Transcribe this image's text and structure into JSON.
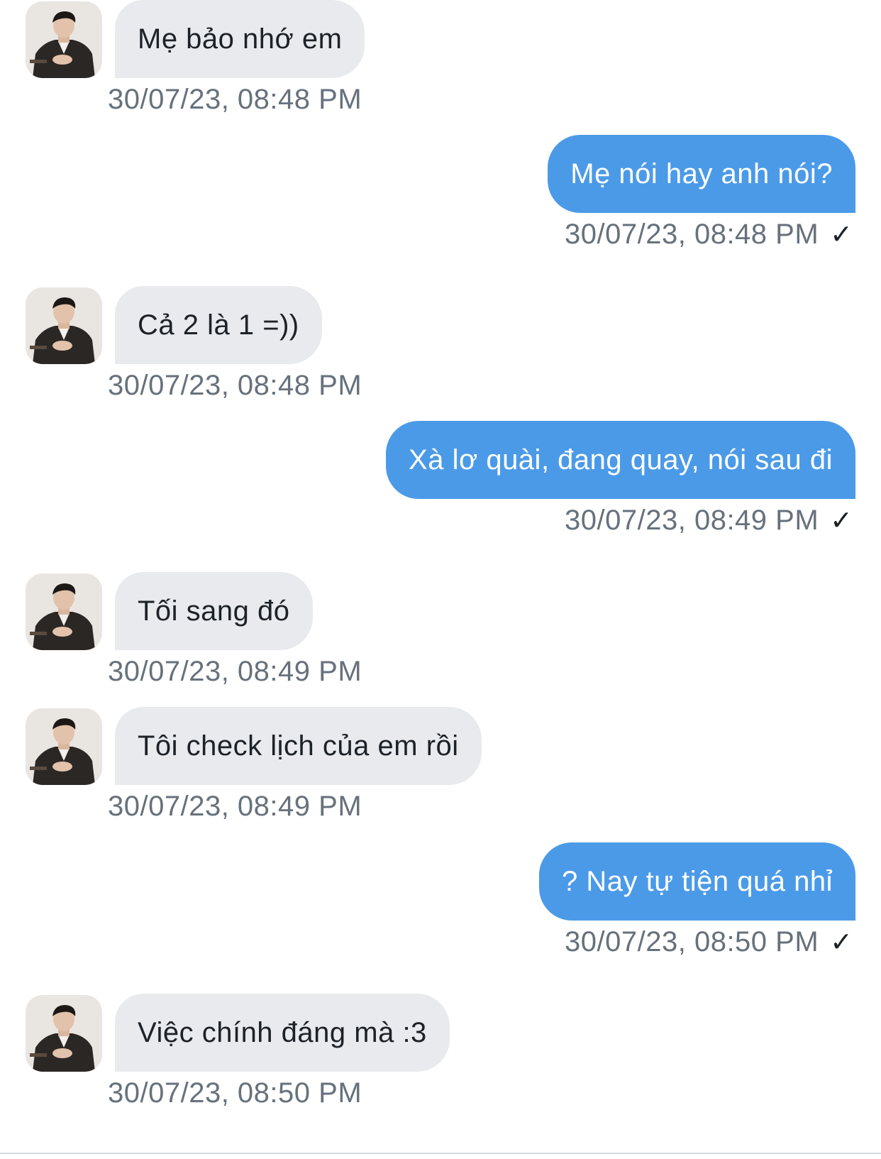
{
  "conversation": {
    "messages": [
      {
        "direction": "incoming",
        "text": "Mẹ bảo nhớ em",
        "time": "30/07/23, 08:48 PM"
      },
      {
        "direction": "outgoing",
        "text": "Mẹ nói hay anh nói?",
        "time": "30/07/23, 08:48 PM",
        "status_icon": "✓"
      },
      {
        "direction": "incoming",
        "text": "Cả 2 là 1 =))",
        "time": "30/07/23, 08:48 PM"
      },
      {
        "direction": "outgoing",
        "text": "Xà lơ quài, đang quay, nói sau đi",
        "time": "30/07/23, 08:49 PM",
        "status_icon": "✓"
      },
      {
        "direction": "incoming",
        "text": "Tối sang đó",
        "time": "30/07/23, 08:49 PM"
      },
      {
        "direction": "incoming",
        "text": "Tôi check lịch của em rồi",
        "time": "30/07/23, 08:49 PM"
      },
      {
        "direction": "outgoing",
        "text": "? Nay tự tiện quá nhỉ",
        "time": "30/07/23, 08:50 PM",
        "status_icon": "✓"
      },
      {
        "direction": "incoming",
        "text": "Việc chính đáng mà :3",
        "time": "30/07/23, 08:50 PM"
      }
    ]
  },
  "colors": {
    "incoming_bubble": "#e8eaed",
    "outgoing_bubble": "#4b9ae8",
    "timestamp": "#67717c",
    "text": "#1d2228"
  },
  "icons": {
    "avatar": "avatar-photo",
    "read_receipt": "check-icon"
  }
}
